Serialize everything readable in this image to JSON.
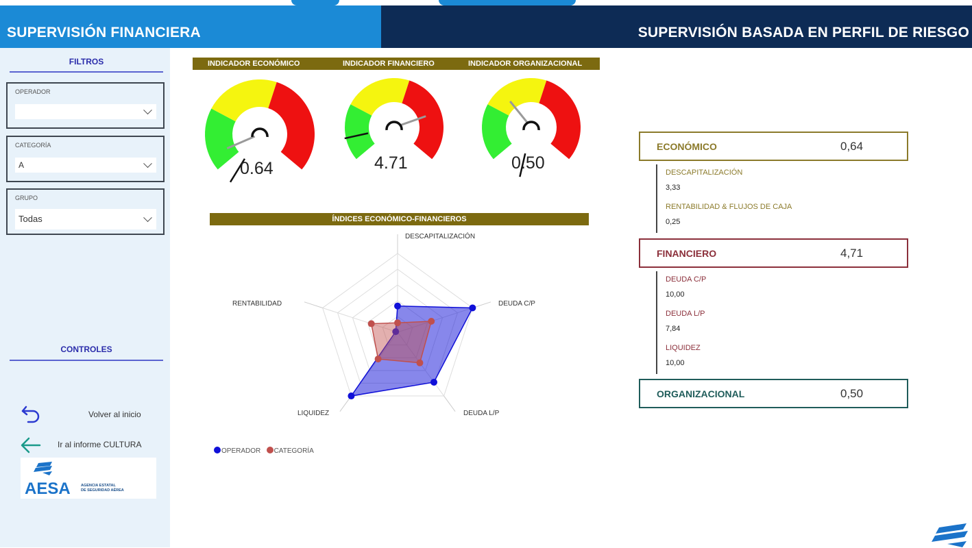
{
  "header": {
    "left_title": "SUPERVISIÓN FINANCIERA",
    "right_title": "SUPERVISIÓN BASADA EN PERFIL DE RIESGO"
  },
  "sidebar": {
    "filters_title": "FILTROS",
    "filters": [
      {
        "label": "OPERADOR",
        "value": ""
      },
      {
        "label": "CATEGORÍA",
        "value": "A"
      },
      {
        "label": "GRUPO",
        "value": "Todas"
      }
    ],
    "controls_title": "CONTROLES",
    "controls": [
      {
        "label": "Volver al inicio",
        "icon": "undo-arrow-icon"
      },
      {
        "label": "Ir al informe CULTURA",
        "icon": "arrow-left-icon"
      }
    ],
    "logo": {
      "brand": "AESA",
      "line1": "AGENCIA ESTATAL",
      "line2": "DE SEGURIDAD AÉREA"
    }
  },
  "gauges": {
    "header_labels": [
      "INDICADOR ECONÓMICO",
      "INDICADOR FINANCIERO",
      "INDICADOR ORGANIZACIONAL"
    ],
    "items": [
      {
        "value": 0.64,
        "display": "0.64"
      },
      {
        "value": 4.71,
        "display": "4.71"
      },
      {
        "value": 0.5,
        "display": "0.50"
      }
    ],
    "colors": {
      "green": "#33ee33",
      "yellow": "#f5f50f",
      "red": "#ee1111"
    }
  },
  "chart_data": {
    "type": "radar",
    "title": "ÍNDICES ECONÓMICO-FINANCIEROS",
    "axes": [
      "DESCAPITALIZACIÓN",
      "DEUDA C/P",
      "DEUDA L/P",
      "LIQUIDEZ",
      "RENTABILIDAD"
    ],
    "rmax": 10,
    "series": [
      {
        "name": "OPERADOR",
        "color": "#1010d8",
        "values": [
          3.33,
          10.0,
          7.84,
          10.0,
          0.25
        ]
      },
      {
        "name": "CATEGORÍA",
        "color": "#c0504d",
        "values": [
          1.2,
          4.5,
          4.8,
          4.2,
          3.5
        ]
      }
    ],
    "legend": "bottom-left"
  },
  "indicators": [
    {
      "name": "ECONÓMICO",
      "value": "0,64",
      "color": "#8b7a2a",
      "subs": [
        {
          "label": "DESCAPITALIZACIÓN",
          "value": "3,33"
        },
        {
          "label": "RENTABILIDAD & FLUJOS DE CAJA",
          "value": "0,25"
        }
      ]
    },
    {
      "name": "FINANCIERO",
      "value": "4,71",
      "color": "#8b2f3a",
      "subs": [
        {
          "label": "DEUDA C/P",
          "value": "10,00"
        },
        {
          "label": "DEUDA L/P",
          "value": "7,84"
        },
        {
          "label": "LIQUIDEZ",
          "value": "10,00"
        }
      ]
    },
    {
      "name": "ORGANIZACIONAL",
      "value": "0,50",
      "color": "#1f5c5a",
      "subs": []
    }
  ]
}
